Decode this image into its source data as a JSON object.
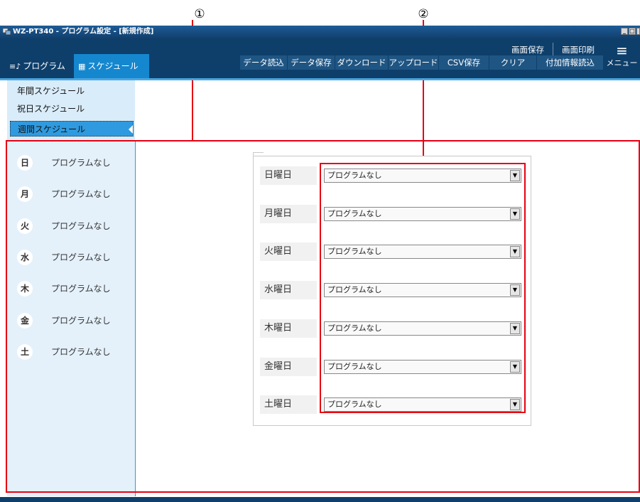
{
  "callouts": [
    "①",
    "②"
  ],
  "window": {
    "title": "WZ-PT340 - プログラム設定 - [新規作成]",
    "min": "_",
    "max": "□"
  },
  "tabs": {
    "program": "プログラム",
    "schedule": "スケジュール"
  },
  "toolbar": {
    "screen_save": "画面保存",
    "screen_print": "画面印刷",
    "data_read": "データ読込",
    "data_save": "データ保存",
    "download": "ダウンロード",
    "upload": "アップロード",
    "csv_save": "CSV保存",
    "clear": "クリア",
    "extra_info_read": "付加情報読込",
    "menu": "メニュー"
  },
  "schedule_menu": [
    "年間スケジュール",
    "祝日スケジュール",
    "週間スケジュール"
  ],
  "week_summary": [
    {
      "badge": "日",
      "program": "プログラムなし"
    },
    {
      "badge": "月",
      "program": "プログラムなし"
    },
    {
      "badge": "火",
      "program": "プログラムなし"
    },
    {
      "badge": "水",
      "program": "プログラムなし"
    },
    {
      "badge": "木",
      "program": "プログラムなし"
    },
    {
      "badge": "金",
      "program": "プログラムなし"
    },
    {
      "badge": "土",
      "program": "プログラムなし"
    }
  ],
  "week_form": [
    {
      "day": "日曜日",
      "value": "プログラムなし"
    },
    {
      "day": "月曜日",
      "value": "プログラムなし"
    },
    {
      "day": "火曜日",
      "value": "プログラムなし"
    },
    {
      "day": "水曜日",
      "value": "プログラムなし"
    },
    {
      "day": "木曜日",
      "value": "プログラムなし"
    },
    {
      "day": "金曜日",
      "value": "プログラムなし"
    },
    {
      "day": "土曜日",
      "value": "プログラムなし"
    }
  ],
  "colors": {
    "toolbar": "#0e3f6b",
    "accent": "#1487cf",
    "highlight": "#e60012"
  }
}
